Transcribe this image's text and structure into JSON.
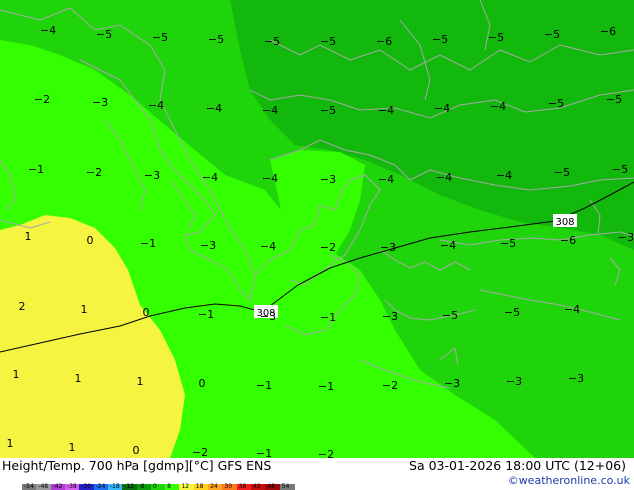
{
  "footer": {
    "title": "Height/Temp. 700 hPa [gdmp][°C] GFS ENS",
    "datetime": "Sa 03-01-2026 18:00 UTC (12+06)",
    "credit": "©weatheronline.co.uk"
  },
  "colors": {
    "temp_yellow": "#f5f541",
    "temp_green_light": "#33ff00",
    "temp_green_mid": "#1fd40a",
    "temp_green_dark": "#12b80c",
    "coastline": "#a8a8a8",
    "contour": "#000000"
  },
  "contour_labels": [
    "308",
    "308"
  ],
  "temperature_labels": [
    {
      "t": "-4"
    },
    {
      "t": "-5"
    },
    {
      "t": "-5"
    },
    {
      "t": "-5"
    },
    {
      "t": "-5"
    },
    {
      "t": "-5"
    },
    {
      "t": "-6"
    },
    {
      "t": "-5"
    },
    {
      "t": "-5"
    },
    {
      "t": "-5"
    },
    {
      "t": "-6"
    },
    {
      "t": "-2"
    },
    {
      "t": "-3"
    },
    {
      "t": "-4"
    },
    {
      "t": "-4"
    },
    {
      "t": "-4"
    },
    {
      "t": "-5"
    },
    {
      "t": "-4"
    },
    {
      "t": "-4"
    },
    {
      "t": "-4"
    },
    {
      "t": "-5"
    },
    {
      "t": "-5"
    },
    {
      "t": "-1"
    },
    {
      "t": "-2"
    },
    {
      "t": "-3"
    },
    {
      "t": "-4"
    },
    {
      "t": "-4"
    },
    {
      "t": "-3"
    },
    {
      "t": "-4"
    },
    {
      "t": "-4"
    },
    {
      "t": "-4"
    },
    {
      "t": "-5"
    },
    {
      "t": "-5"
    },
    {
      "t": "1"
    },
    {
      "t": "0"
    },
    {
      "t": "-1"
    },
    {
      "t": "-3"
    },
    {
      "t": "-4"
    },
    {
      "t": "-2"
    },
    {
      "t": "-3"
    },
    {
      "t": "-4"
    },
    {
      "t": "-5"
    },
    {
      "t": "-6"
    },
    {
      "t": "-3"
    },
    {
      "t": "2"
    },
    {
      "t": "1"
    },
    {
      "t": "0"
    },
    {
      "t": "-1"
    },
    {
      "t": "-3"
    },
    {
      "t": "-1"
    },
    {
      "t": "-3"
    },
    {
      "t": "-5"
    },
    {
      "t": "-5"
    },
    {
      "t": "-4"
    },
    {
      "t": "1"
    },
    {
      "t": "1"
    },
    {
      "t": "1"
    },
    {
      "t": "0"
    },
    {
      "t": "-1"
    },
    {
      "t": "-1"
    },
    {
      "t": "-2"
    },
    {
      "t": "-3"
    },
    {
      "t": "-3"
    },
    {
      "t": "-3"
    },
    {
      "t": "1"
    },
    {
      "t": "1"
    },
    {
      "t": "0"
    },
    {
      "t": "-2"
    },
    {
      "t": "-1"
    },
    {
      "t": "-2"
    }
  ],
  "scale_ticks": [
    "-54",
    "-48",
    "-42",
    "-38",
    "-30",
    "-24",
    "-18",
    "-12",
    "-8",
    "0",
    "8",
    "12",
    "18",
    "24",
    "30",
    "38",
    "42",
    "48",
    "54"
  ],
  "scale_colors": [
    "#7a7a7a",
    "#9b9b9b",
    "#b13dd6",
    "#d85cf0",
    "#2424c8",
    "#1e6ff0",
    "#38b8ff",
    "#0c6e0c",
    "#0c9e0c",
    "#1fd40a",
    "#33ff00",
    "#f5f541",
    "#ffd21e",
    "#ffa51e",
    "#ff781e",
    "#f01e1e",
    "#c80c0c",
    "#a00a0a",
    "#7a7a7a"
  ]
}
